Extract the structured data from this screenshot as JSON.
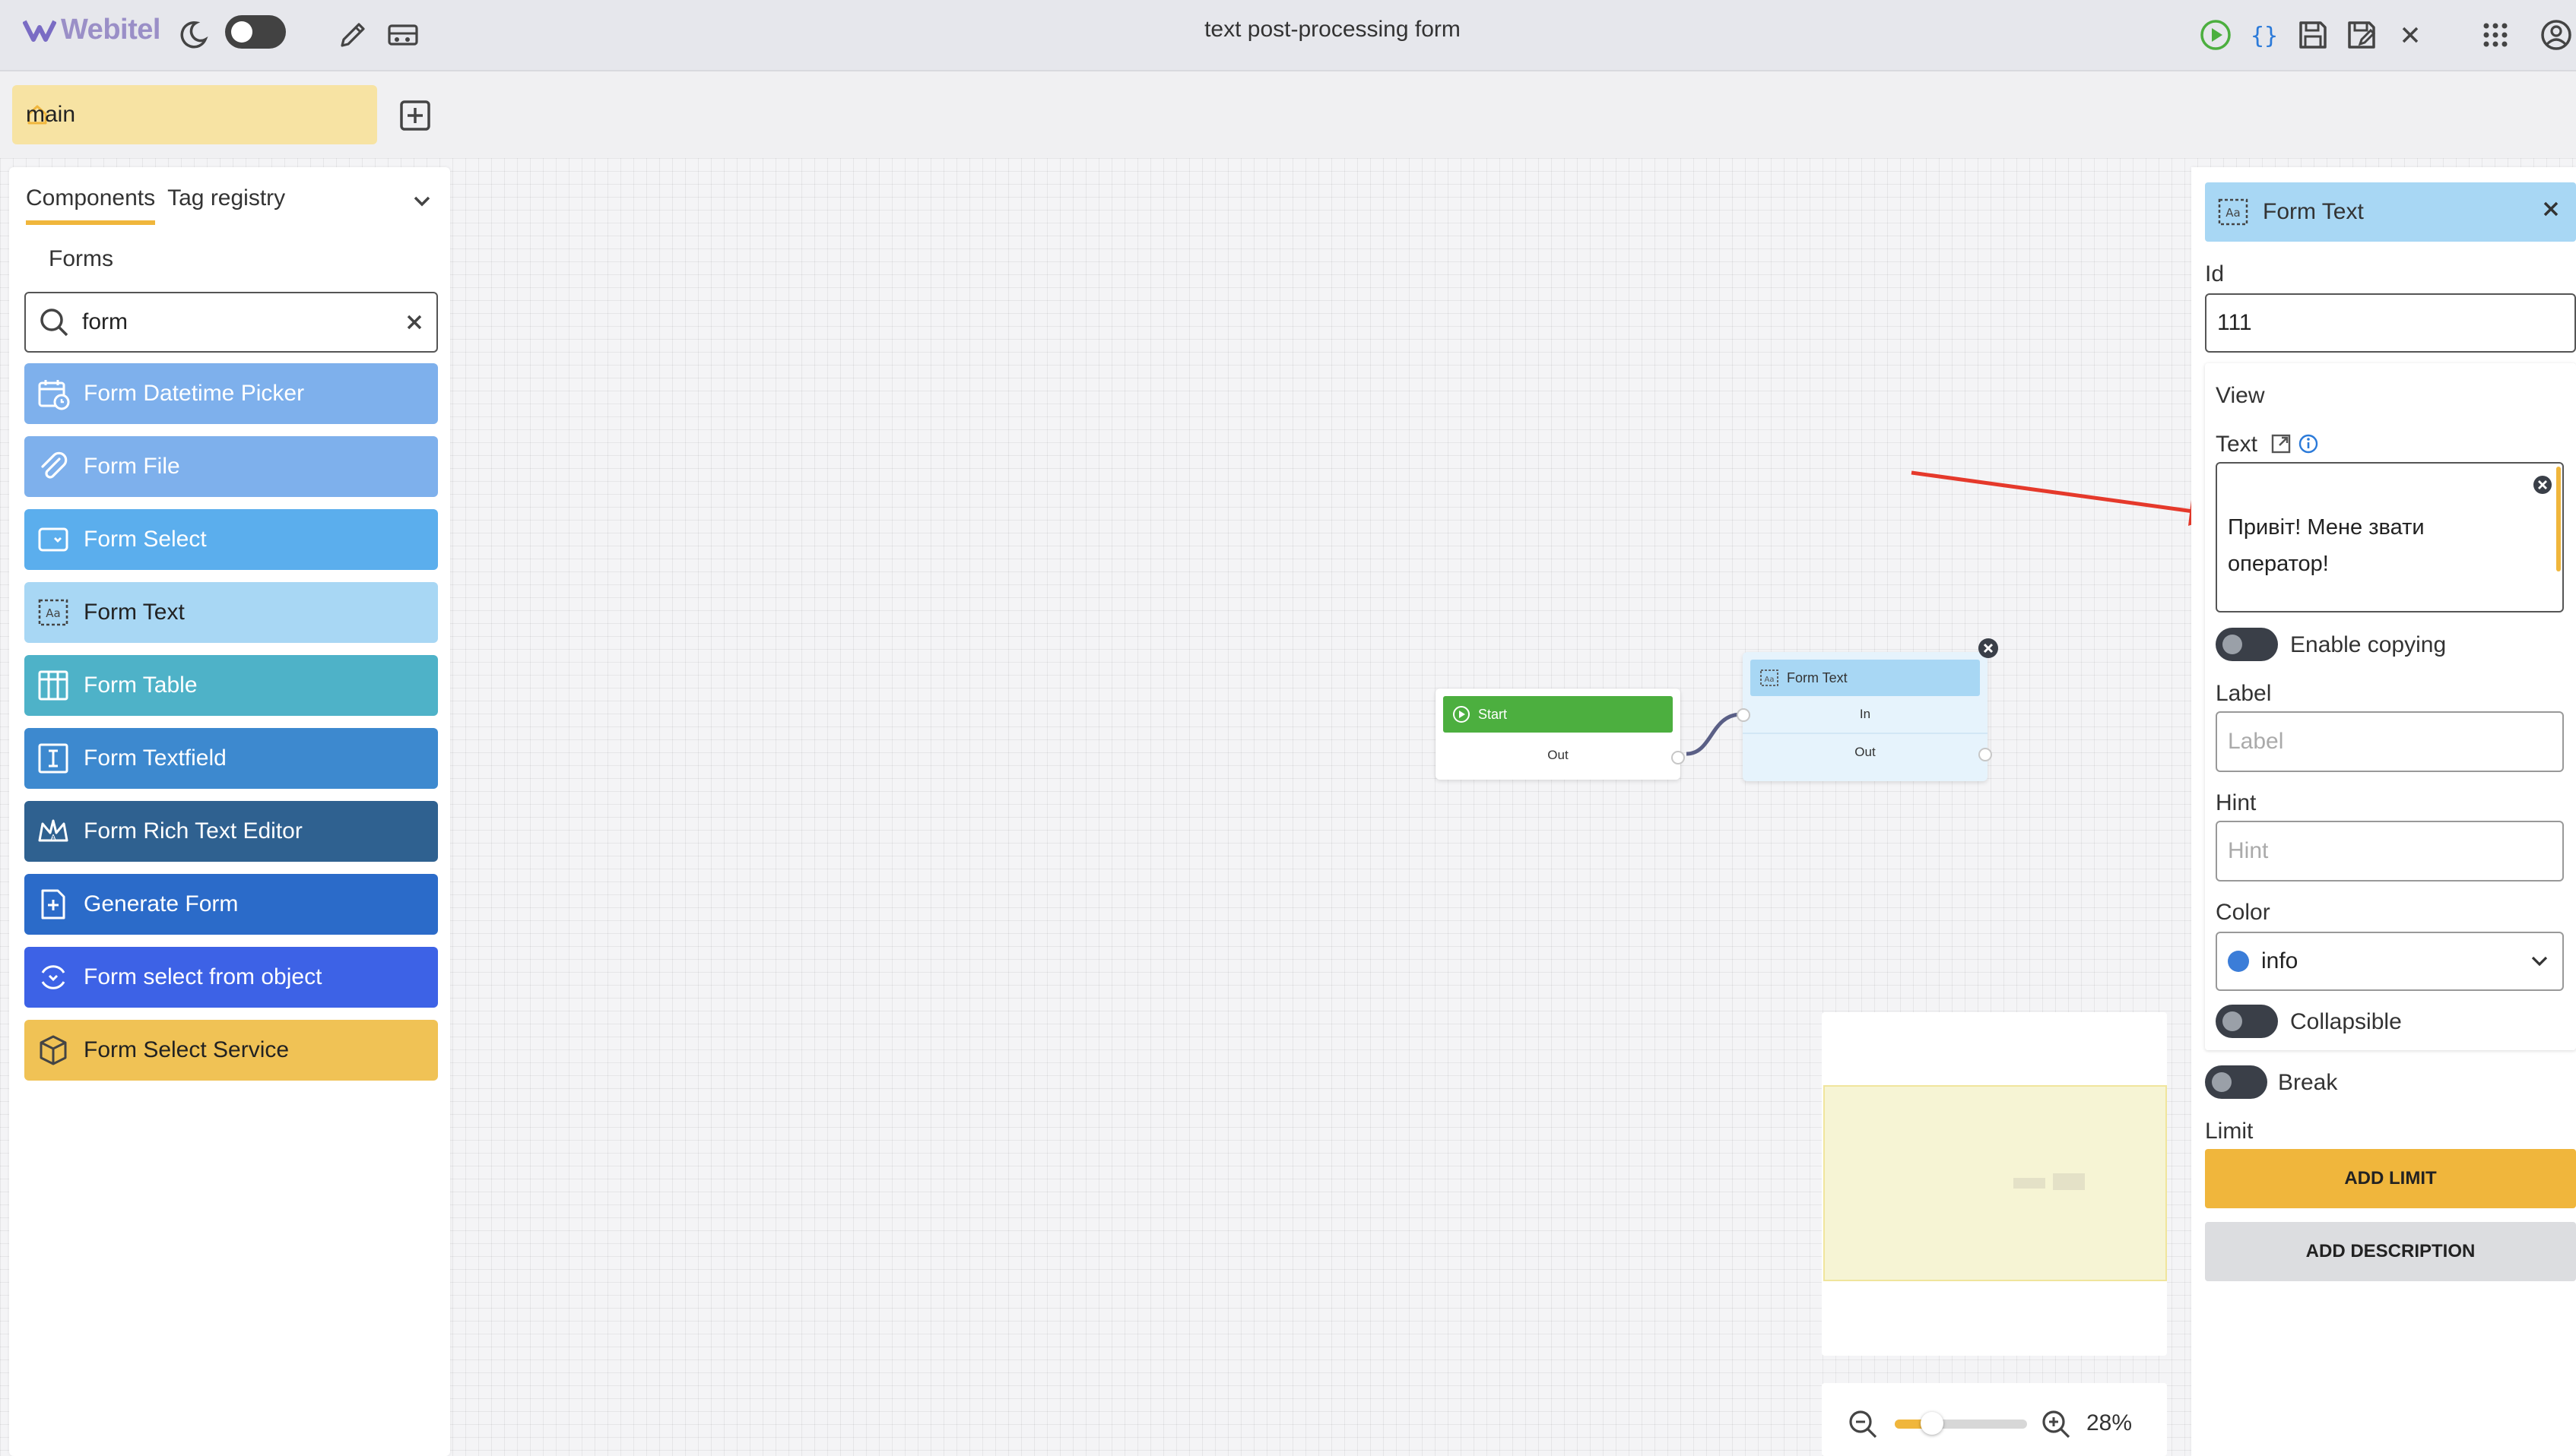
{
  "app": {
    "logo_text": "Webitel",
    "title": "text post-processing form",
    "accent_color": "#f0b63c"
  },
  "toolbar": {
    "left_icons": [
      "theme-moon-icon",
      "pencil-icon",
      "schema-settings-icon"
    ],
    "right_icons": [
      "play-icon",
      "json-braces-icon",
      "save-icon",
      "save-as-icon",
      "close-icon",
      "apps-grid-icon",
      "account-icon"
    ]
  },
  "tabs": {
    "main_label": "main"
  },
  "left_panel": {
    "tab_components": "Components",
    "tab_tag_registry": "Tag registry",
    "section_title": "Forms",
    "search_value": "form",
    "components": [
      {
        "label": "Form Datetime Picker",
        "icon": "calendar-clock-icon",
        "color": "#7eb0ec"
      },
      {
        "label": "Form File",
        "icon": "paperclip-icon",
        "color": "#7eb0ec"
      },
      {
        "label": "Form Select",
        "icon": "select-box-icon",
        "color": "#5baeed"
      },
      {
        "label": "Form Text",
        "icon": "text-frame-icon",
        "color": "#a8d7f4"
      },
      {
        "label": "Form Table",
        "icon": "table-icon",
        "color": "#4eb2c8"
      },
      {
        "label": "Form Textfield",
        "icon": "textfield-cursor-icon",
        "color": "#3d89cf"
      },
      {
        "label": "Form Rich Text Editor",
        "icon": "crown-icon",
        "color": "#2f6190"
      },
      {
        "label": "Generate Form",
        "icon": "document-plus-icon",
        "color": "#2b6bc9"
      },
      {
        "label": "Form select from object",
        "icon": "circle-select-icon",
        "color": "#3d62e6"
      },
      {
        "label": "Form Select Service",
        "icon": "cube-icon",
        "color": "#f0c255"
      }
    ]
  },
  "nodes": {
    "start": {
      "title": "Start",
      "out": "Out",
      "color": "#4caf3f"
    },
    "form_text": {
      "title": "Form Text",
      "in": "In",
      "out": "Out",
      "color": "#a8d7f4"
    }
  },
  "right_panel": {
    "title": "Form Text",
    "id_label": "Id",
    "id_value": "111",
    "view_label": "View",
    "text_label": "Text",
    "text_value": "Привіт! Мене звати\nоператор!\n\nЗмінна: ${тут буде",
    "enable_copying_label": "Enable copying",
    "label_label": "Label",
    "label_placeholder": "Label",
    "hint_label": "Hint",
    "hint_placeholder": "Hint",
    "color_label": "Color",
    "color_value": "info",
    "color_dot": "#3b7dd8",
    "collapsible_label": "Collapsible",
    "break_label": "Break",
    "limit_label": "Limit",
    "add_limit_button": "ADD LIMIT",
    "add_description_button": "ADD DESCRIPTION"
  },
  "zoom": {
    "percent_label": "28%",
    "level_fraction": 0.28
  }
}
